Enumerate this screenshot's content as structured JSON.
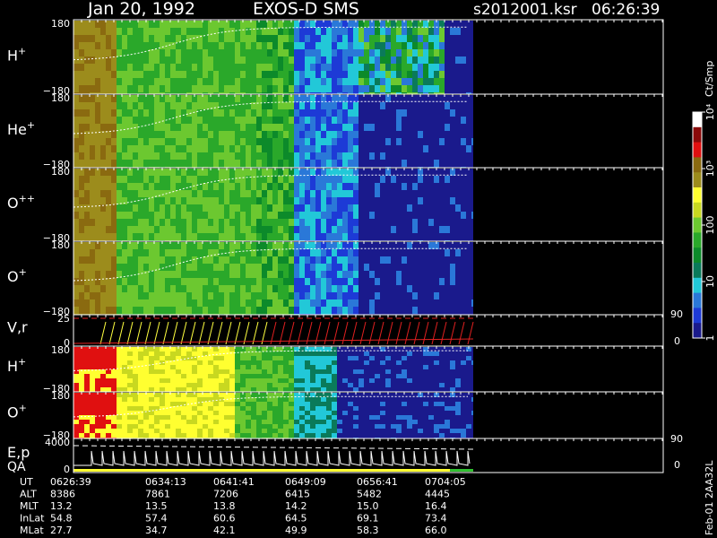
{
  "header": {
    "date": "Jan 20, 1992",
    "instrument": "EXOS-D SMS",
    "file": "s2012001.ksr",
    "time": "06:26:39"
  },
  "colorbar": {
    "unit_label": "Ct/Smp",
    "ticks": [
      {
        "label": "10⁴",
        "value": 10000
      },
      {
        "label": "10³",
        "value": 1000
      },
      {
        "label": "100",
        "value": 100
      },
      {
        "label": "10",
        "value": 10
      },
      {
        "label": "1",
        "value": 1
      }
    ],
    "colors": [
      "#1a1a8c",
      "#1d3ad6",
      "#2a78d8",
      "#22c8d8",
      "#0a7a5a",
      "#0c8a2a",
      "#2aa82a",
      "#6cc830",
      "#c8d820",
      "#ffff30",
      "#9c8c1c",
      "#8a6a10",
      "#e01010",
      "#8a0a0a",
      "#ffffff"
    ]
  },
  "side_labels": {
    "r90a": "90",
    "r0a": "0",
    "r90b": "90",
    "r0b": "0",
    "footer": "Feb-01 2AA32L"
  },
  "axis_rows": [
    {
      "label": "UT",
      "values": [
        "0626:39",
        "0634:13",
        "0641:41",
        "0649:09",
        "0656:41",
        "0704:05"
      ]
    },
    {
      "label": "ALT",
      "values": [
        "8386",
        "7861",
        "7206",
        "6415",
        "5482",
        "4445"
      ]
    },
    {
      "label": "MLT",
      "values": [
        "13.2",
        "13.5",
        "13.8",
        "14.2",
        "15.0",
        "16.4"
      ]
    },
    {
      "label": "InLat",
      "values": [
        "54.8",
        "57.4",
        "60.6",
        "64.5",
        "69.1",
        "73.4"
      ]
    },
    {
      "label": "MLat",
      "values": [
        "27.7",
        "34.7",
        "42.1",
        "49.9",
        "58.3",
        "66.0"
      ]
    }
  ],
  "panels": [
    {
      "species": "H",
      "sup": "+",
      "ytop": "180",
      "ybot": "−180"
    },
    {
      "species": "He",
      "sup": "+",
      "ytop": "180",
      "ybot": "−180"
    },
    {
      "species": "O",
      "sup": "++",
      "ytop": "180",
      "ybot": "−180"
    },
    {
      "species": "O",
      "sup": "+",
      "ytop": "180",
      "ybot": "−180"
    },
    {
      "species": "V,r",
      "sup": "",
      "ytop": "25",
      "ybot": "0"
    },
    {
      "species": "H",
      "sup": "+",
      "ytop": "180",
      "ybot": "−180"
    },
    {
      "species": "O",
      "sup": "+",
      "ytop": "180",
      "ybot": "−180"
    },
    {
      "species": "E,p",
      "sup": "",
      "ytop": "4000",
      "ybot": "0",
      "extra": "QA"
    }
  ],
  "chart_data": {
    "type": "heatmap",
    "x_axis_label": "UT",
    "x_ticks": [
      "0626:39",
      "0634:13",
      "0641:41",
      "0649:09",
      "0656:41",
      "0704:05"
    ],
    "colorscale": "log",
    "colorbar_range": [
      1,
      10000
    ],
    "colorbar_unit": "Ct/Smp",
    "panels": [
      {
        "name": "H+",
        "ylim": [
          -180,
          180
        ]
      },
      {
        "name": "He+",
        "ylim": [
          -180,
          180
        ]
      },
      {
        "name": "O++",
        "ylim": [
          -180,
          180
        ]
      },
      {
        "name": "O+",
        "ylim": [
          -180,
          180
        ]
      },
      {
        "name": "V,r",
        "ylim": [
          0,
          25
        ],
        "right_ylim": [
          0,
          90
        ]
      },
      {
        "name": "H+",
        "ylim": [
          -180,
          180
        ]
      },
      {
        "name": "O+",
        "ylim": [
          -180,
          180
        ]
      },
      {
        "name": "E,p",
        "ylim": [
          0,
          4000
        ],
        "right_ylim": [
          0,
          90
        ]
      }
    ]
  }
}
